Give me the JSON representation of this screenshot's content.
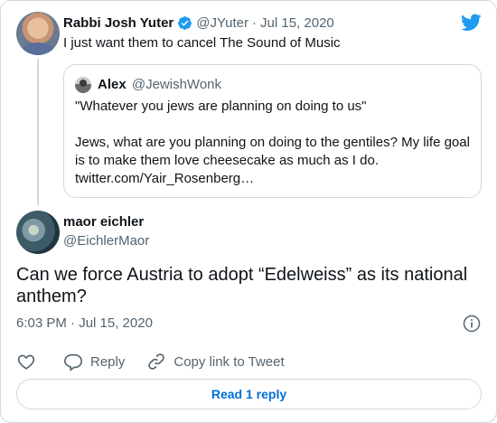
{
  "tweet": {
    "author_name": "Rabbi Josh Yuter",
    "author_handle": "@JYuter",
    "separator": "·",
    "date": "Jul 15, 2020",
    "text": "I just want them to cancel The Sound of Music",
    "icons": {
      "verified": "verified-badge-icon",
      "logo": "twitter-bird-icon"
    },
    "colors": {
      "brand": "#1d9bf0",
      "secondary": "#536471"
    }
  },
  "quote": {
    "author_name": "Alex",
    "author_handle": "@JewishWonk",
    "line1": "\"Whatever you jews are planning on doing to us\"",
    "line2": "Jews, what are you planning on doing to the gentiles? My life goal is to make them love cheesecake as much as I do.",
    "link": "twitter.com/Yair_Rosenberg…"
  },
  "reply": {
    "author_name": "maor eichler",
    "author_handle": "@EichlerMaor",
    "text": "Can we force Austria to adopt “Edelweiss” as its national anthem?",
    "timestamp": "6:03 PM · Jul 15, 2020"
  },
  "actions": {
    "reply_label": "Reply",
    "copy_label": "Copy link to Tweet",
    "read_replies_label": "Read 1 reply"
  }
}
